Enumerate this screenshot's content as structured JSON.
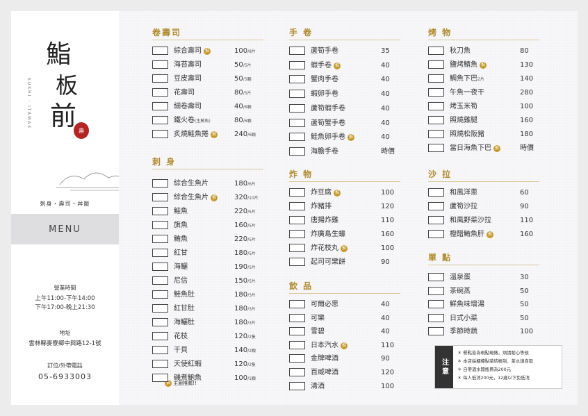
{
  "brand": {
    "logo_chars": [
      "鮨",
      "板",
      "前"
    ],
    "vertical_sub": "SUSHI · ITAMAE",
    "seal": "壽",
    "tagline": "刺身・壽司・丼飯",
    "menu_label": "MENU"
  },
  "hours": {
    "heading": "營業時間",
    "lines": [
      "上午11:00-下午14:00",
      "下午17:00-晚上21:30"
    ]
  },
  "address": {
    "heading": "地址",
    "value": "雲林縣麥寮鄉中興路12-1號"
  },
  "phone": {
    "heading": "訂位/外帶電話",
    "value": "05-6933003"
  },
  "legend": {
    "badge": "推",
    "text": "主廚推薦!!"
  },
  "sections": [
    {
      "title": "卷壽司",
      "items": [
        {
          "name": "綜合壽司",
          "badge": true,
          "price": "100",
          "unit": "/8片"
        },
        {
          "name": "海苔壽司",
          "price": "50",
          "unit": "/5片"
        },
        {
          "name": "豆皮壽司",
          "price": "50",
          "unit": "/5顆"
        },
        {
          "name": "花壽司",
          "price": "80",
          "unit": "/5片"
        },
        {
          "name": "細卷壽司",
          "price": "40",
          "unit": "/6顆"
        },
        {
          "name": "鐵火卷",
          "note": "(生鮪魚)",
          "price": "80",
          "unit": "/6顆"
        },
        {
          "name": "炙燒鮭魚捲",
          "badge": true,
          "price": "240",
          "unit": "/6顆"
        }
      ]
    },
    {
      "title": "刺 身",
      "items": [
        {
          "name": "綜合生魚片",
          "price": "180",
          "unit": "/6片"
        },
        {
          "name": "綜合生魚片",
          "badge": true,
          "price": "320",
          "unit": "/10片"
        },
        {
          "name": "鮭魚",
          "price": "220",
          "unit": "/5片"
        },
        {
          "name": "旗魚",
          "price": "160",
          "unit": "/5片"
        },
        {
          "name": "鮪魚",
          "price": "220",
          "unit": "/5片"
        },
        {
          "name": "紅甘",
          "price": "180",
          "unit": "/5片"
        },
        {
          "name": "海鱺",
          "price": "190",
          "unit": "/5片"
        },
        {
          "name": "尼信",
          "price": "150",
          "unit": "/5片"
        },
        {
          "name": "鮭魚肚",
          "price": "180",
          "unit": "/3片"
        },
        {
          "name": "紅甘肚",
          "price": "180",
          "unit": "/3片"
        },
        {
          "name": "海鱺肚",
          "price": "180",
          "unit": "/3片"
        },
        {
          "name": "花枝",
          "price": "120",
          "unit": "/2隻"
        },
        {
          "name": "干貝",
          "price": "140",
          "unit": "/2顆"
        },
        {
          "name": "天使紅蝦",
          "price": "120",
          "unit": "/2隻"
        },
        {
          "name": "磯煮鮑魚",
          "price": "100",
          "unit": "/1顆"
        }
      ]
    },
    {
      "title": "手 卷",
      "items": [
        {
          "name": "蘆筍手卷",
          "price": "35"
        },
        {
          "name": "蝦手卷",
          "badge": true,
          "price": "40"
        },
        {
          "name": "蟹肉手卷",
          "price": "40"
        },
        {
          "name": "蝦卵手卷",
          "price": "40"
        },
        {
          "name": "蘆筍蝦手卷",
          "price": "40"
        },
        {
          "name": "蘆筍蟹手卷",
          "price": "40"
        },
        {
          "name": "鮭魚卵手卷",
          "badge": true,
          "price": "40"
        },
        {
          "name": "海膽手卷",
          "price": "時價"
        }
      ]
    },
    {
      "title": "炸 物",
      "items": [
        {
          "name": "炸豆腐",
          "badge": true,
          "price": "100"
        },
        {
          "name": "炸豬排",
          "price": "120"
        },
        {
          "name": "唐揚炸雞",
          "price": "110"
        },
        {
          "name": "炸廣島生蠔",
          "price": "160"
        },
        {
          "name": "炸花枝丸",
          "badge": true,
          "price": "100"
        },
        {
          "name": "起司可樂餅",
          "price": "90"
        }
      ]
    },
    {
      "title": "飲 品",
      "items": [
        {
          "name": "可爾必思",
          "price": "40"
        },
        {
          "name": "可樂",
          "price": "40"
        },
        {
          "name": "雪碧",
          "price": "40"
        },
        {
          "name": "日本汽水",
          "badge": true,
          "price": "110"
        },
        {
          "name": "金牌啤酒",
          "price": "90"
        },
        {
          "name": "百威啤酒",
          "price": "120"
        },
        {
          "name": "清酒",
          "price": "100"
        }
      ]
    },
    {
      "title": "烤 物",
      "items": [
        {
          "name": "秋刀魚",
          "price": "80"
        },
        {
          "name": "鹽烤鯖魚",
          "badge": true,
          "price": "130"
        },
        {
          "name": "鯛魚下巴",
          "note": "2片",
          "price": "140"
        },
        {
          "name": "午魚一夜干",
          "price": "280"
        },
        {
          "name": "烤玉米筍",
          "price": "100"
        },
        {
          "name": "照燒雞腿",
          "price": "160"
        },
        {
          "name": "照燒松阪豬",
          "price": "180"
        },
        {
          "name": "當日海魚下巴",
          "badge": true,
          "price": "時價"
        }
      ]
    },
    {
      "title": "沙 拉",
      "items": [
        {
          "name": "和風洋蔥",
          "price": "60"
        },
        {
          "name": "蘆筍沙拉",
          "price": "90"
        },
        {
          "name": "和風野菜沙拉",
          "price": "110"
        },
        {
          "name": "橙醋鮪魚肝",
          "badge": true,
          "price": "160"
        }
      ]
    },
    {
      "title": "單 點",
      "items": [
        {
          "name": "溫泉蛋",
          "price": "30"
        },
        {
          "name": "茶碗蒸",
          "price": "50"
        },
        {
          "name": "鮮魚味增湯",
          "price": "50"
        },
        {
          "name": "日式小菜",
          "price": "50"
        },
        {
          "name": "季節時蔬",
          "price": "100"
        }
      ]
    }
  ],
  "notice": {
    "tag": "注意",
    "lines": [
      "＊ 餐點皆為現點現做，煩請耐心等候",
      "＊ 本店採櫃檯點菜結帳制、茶水請自取",
      "＊ 自帶酒水開瓶費為200元",
      "＊ 每人低消200元，12歲以下免低消"
    ]
  },
  "colors": {
    "accent": "#b08a2c",
    "badge": "#c49a2c",
    "seal": "#b32424",
    "menu_band": "#dedee0"
  }
}
